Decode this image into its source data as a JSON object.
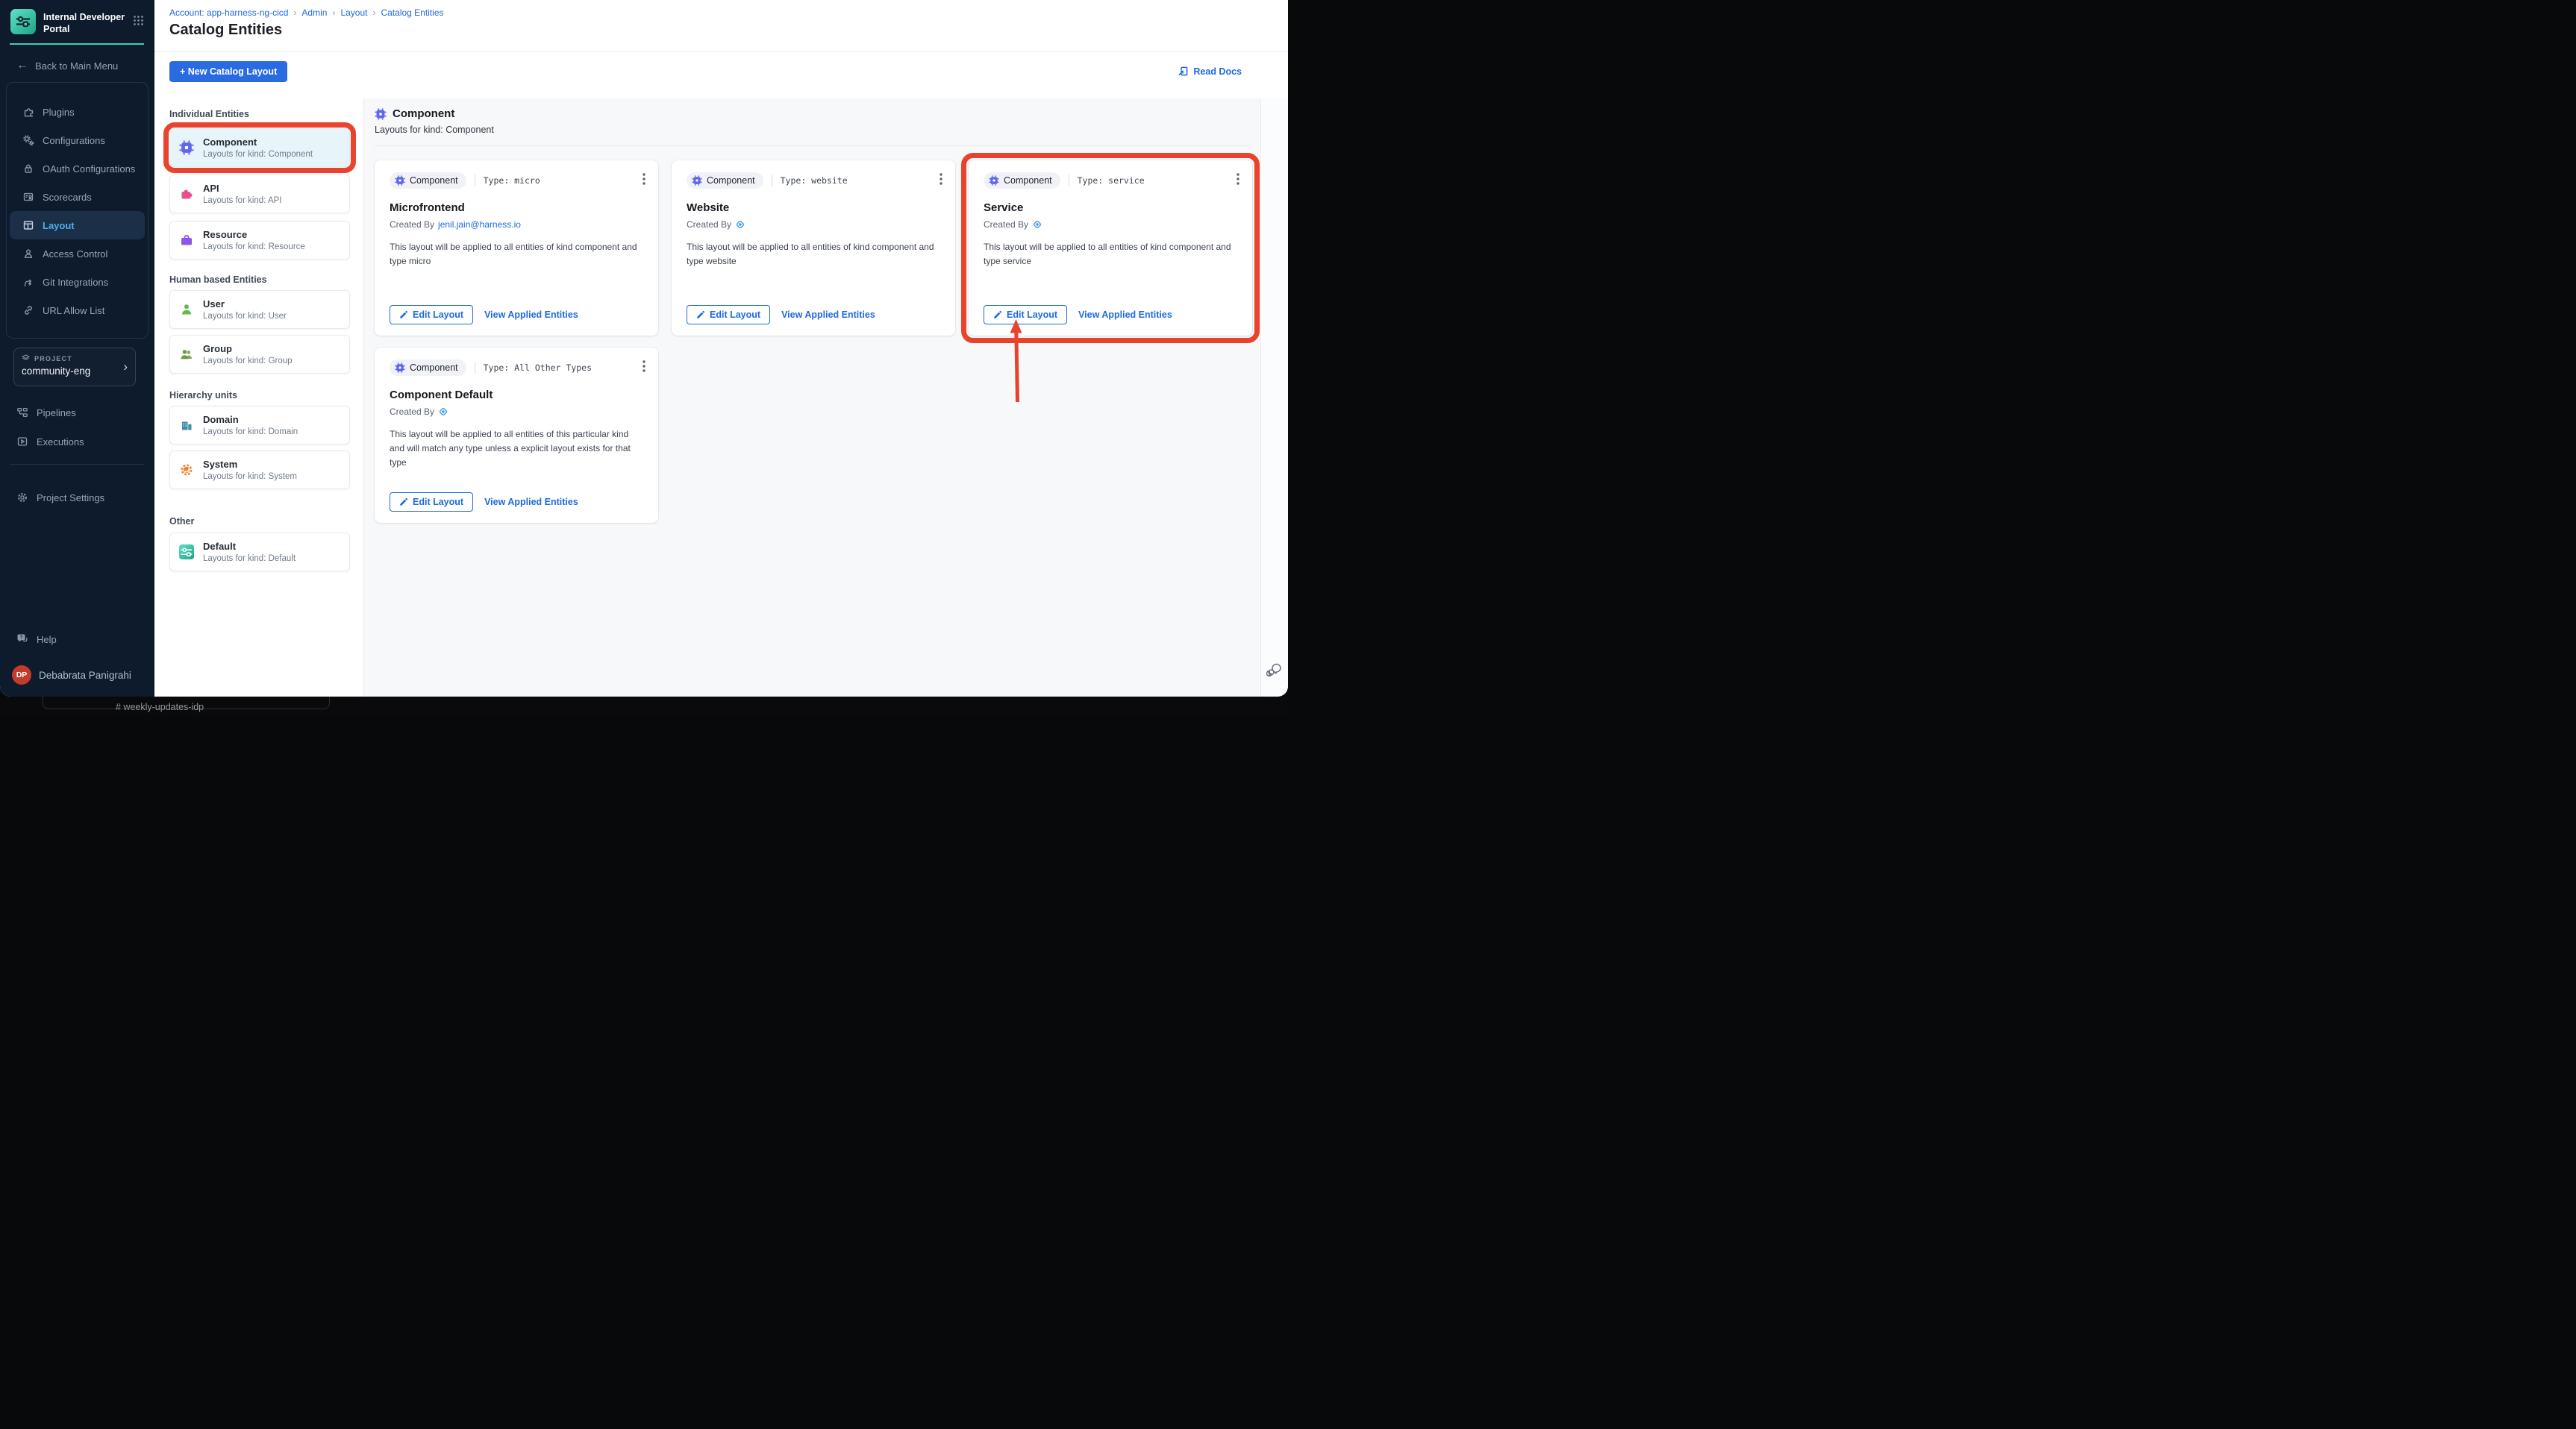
{
  "colors": {
    "sidebar_navy": "#0d1b2d",
    "teal_accent": "#3ecfb2",
    "primary_blue": "#2b6be2",
    "link_blue": "#1f6ae0",
    "annotation_red": "#e8432c",
    "component_indigo": "#5f66ee"
  },
  "brand": {
    "title": "Internal Developer Portal",
    "back_link": "Back to Main Menu"
  },
  "sidebar": {
    "nav": [
      {
        "label": "Plugins"
      },
      {
        "label": "Configurations"
      },
      {
        "label": "OAuth Configurations"
      },
      {
        "label": "Scorecards"
      },
      {
        "label": "Layout",
        "active": true
      },
      {
        "label": "Access Control"
      },
      {
        "label": "Git Integrations"
      },
      {
        "label": "URL Allow List"
      }
    ],
    "project": {
      "eyebrow": "PROJECT",
      "name": "community-eng"
    },
    "pipelines": "Pipelines",
    "executions": "Executions",
    "project_settings": "Project Settings",
    "help": "Help",
    "user": {
      "initials": "DP",
      "name": "Debabrata Panigrahi"
    }
  },
  "header": {
    "breadcrumb": [
      "Account: app-harness-ng-cicd",
      "Admin",
      "Layout",
      "Catalog Entities"
    ],
    "breadcrumb_sep": "›",
    "title": "Catalog Entities",
    "new_button": "+ New Catalog Layout",
    "read_docs": "Read Docs"
  },
  "entity_panel": {
    "sections": [
      {
        "title": "Individual Entities",
        "items": [
          {
            "title": "Component",
            "subtitle": "Layouts for kind: Component",
            "selected": true,
            "annotated": true
          },
          {
            "title": "API",
            "subtitle": "Layouts for kind: API"
          },
          {
            "title": "Resource",
            "subtitle": "Layouts for kind: Resource"
          }
        ]
      },
      {
        "title": "Human based Entities",
        "items": [
          {
            "title": "User",
            "subtitle": "Layouts for kind: User"
          },
          {
            "title": "Group",
            "subtitle": "Layouts for kind: Group"
          }
        ]
      },
      {
        "title": "Hierarchy units",
        "items": [
          {
            "title": "Domain",
            "subtitle": "Layouts for kind: Domain"
          },
          {
            "title": "System",
            "subtitle": "Layouts for kind: System"
          }
        ]
      },
      {
        "title": "Other",
        "items": [
          {
            "title": "Default",
            "subtitle": "Layouts for kind: Default"
          }
        ]
      }
    ]
  },
  "main": {
    "section_title": "Component",
    "section_subtitle": "Layouts for kind: Component",
    "cards": [
      {
        "badge": "Component",
        "type_label": "Type: micro",
        "title": "Microfrontend",
        "created_by": "Created By",
        "created_by_link": "jenil.jain@harness.io",
        "description": "This layout will be applied to all entities of kind component and type micro",
        "edit_label": "Edit Layout",
        "view_label": "View Applied Entities"
      },
      {
        "badge": "Component",
        "type_label": "Type: website",
        "title": "Website",
        "created_by": "Created By",
        "description": "This layout will be applied to all entities of kind component and type website",
        "edit_label": "Edit Layout",
        "view_label": "View Applied Entities"
      },
      {
        "badge": "Component",
        "type_label": "Type: service",
        "title": "Service",
        "created_by": "Created By",
        "description": "This layout will be applied to all entities of kind component and type service",
        "edit_label": "Edit Layout",
        "view_label": "View Applied Entities",
        "annotated": true
      },
      {
        "badge": "Component",
        "type_label": "Type: All Other Types",
        "title": "Component Default",
        "created_by": "Created By",
        "description": "This layout will be applied to all entities of this particular kind and will match any type unless a explicit layout exists for that type",
        "edit_label": "Edit Layout",
        "view_label": "View Applied Entities"
      }
    ]
  },
  "taskbar": {
    "channel": "#  weekly-updates-idp"
  }
}
